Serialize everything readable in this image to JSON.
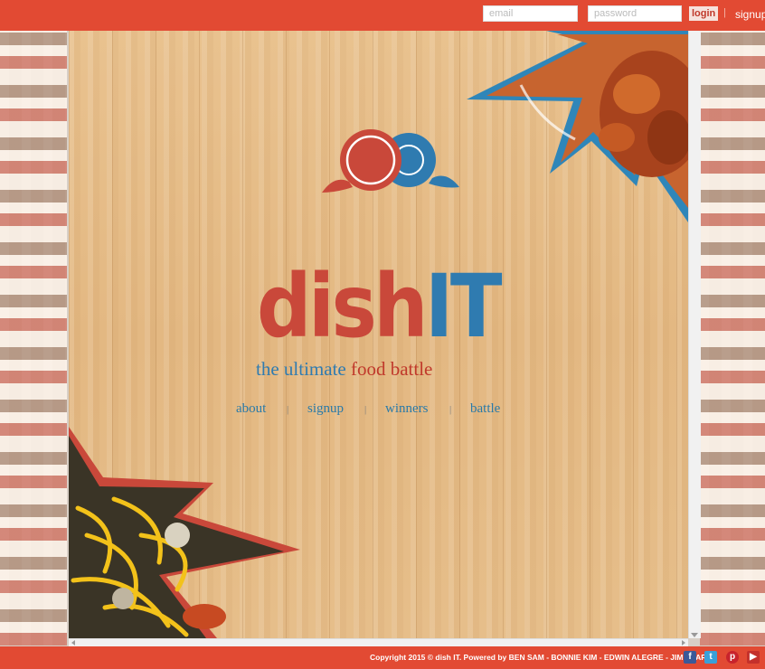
{
  "header": {
    "email_placeholder": "email",
    "password_placeholder": "password",
    "login_label": "login",
    "separator": "|",
    "signup_label": "signup"
  },
  "brand": {
    "logo_word": "dishIT",
    "tagline_part1": "the ultimate",
    "tagline_part2": "food battle"
  },
  "nav": {
    "items": [
      {
        "label": "about"
      },
      {
        "label": "signup"
      },
      {
        "label": "winners"
      },
      {
        "label": "battle"
      }
    ],
    "separator": "|"
  },
  "footer": {
    "copyright": "Copyright 2015 © dish IT. Powered by BEN SAM - BONNIE KIM - EDWIN ALEGRE - JIM CLARK",
    "social": [
      "facebook-icon",
      "twitter-icon",
      "pinterest-icon",
      "youtube-icon"
    ]
  },
  "colors": {
    "brand_red": "#e24a33",
    "logo_red": "#c9483a",
    "logo_blue": "#2f7bb0",
    "nav_blue": "#2a7aa8",
    "burst_blue": "#2f86b9"
  }
}
